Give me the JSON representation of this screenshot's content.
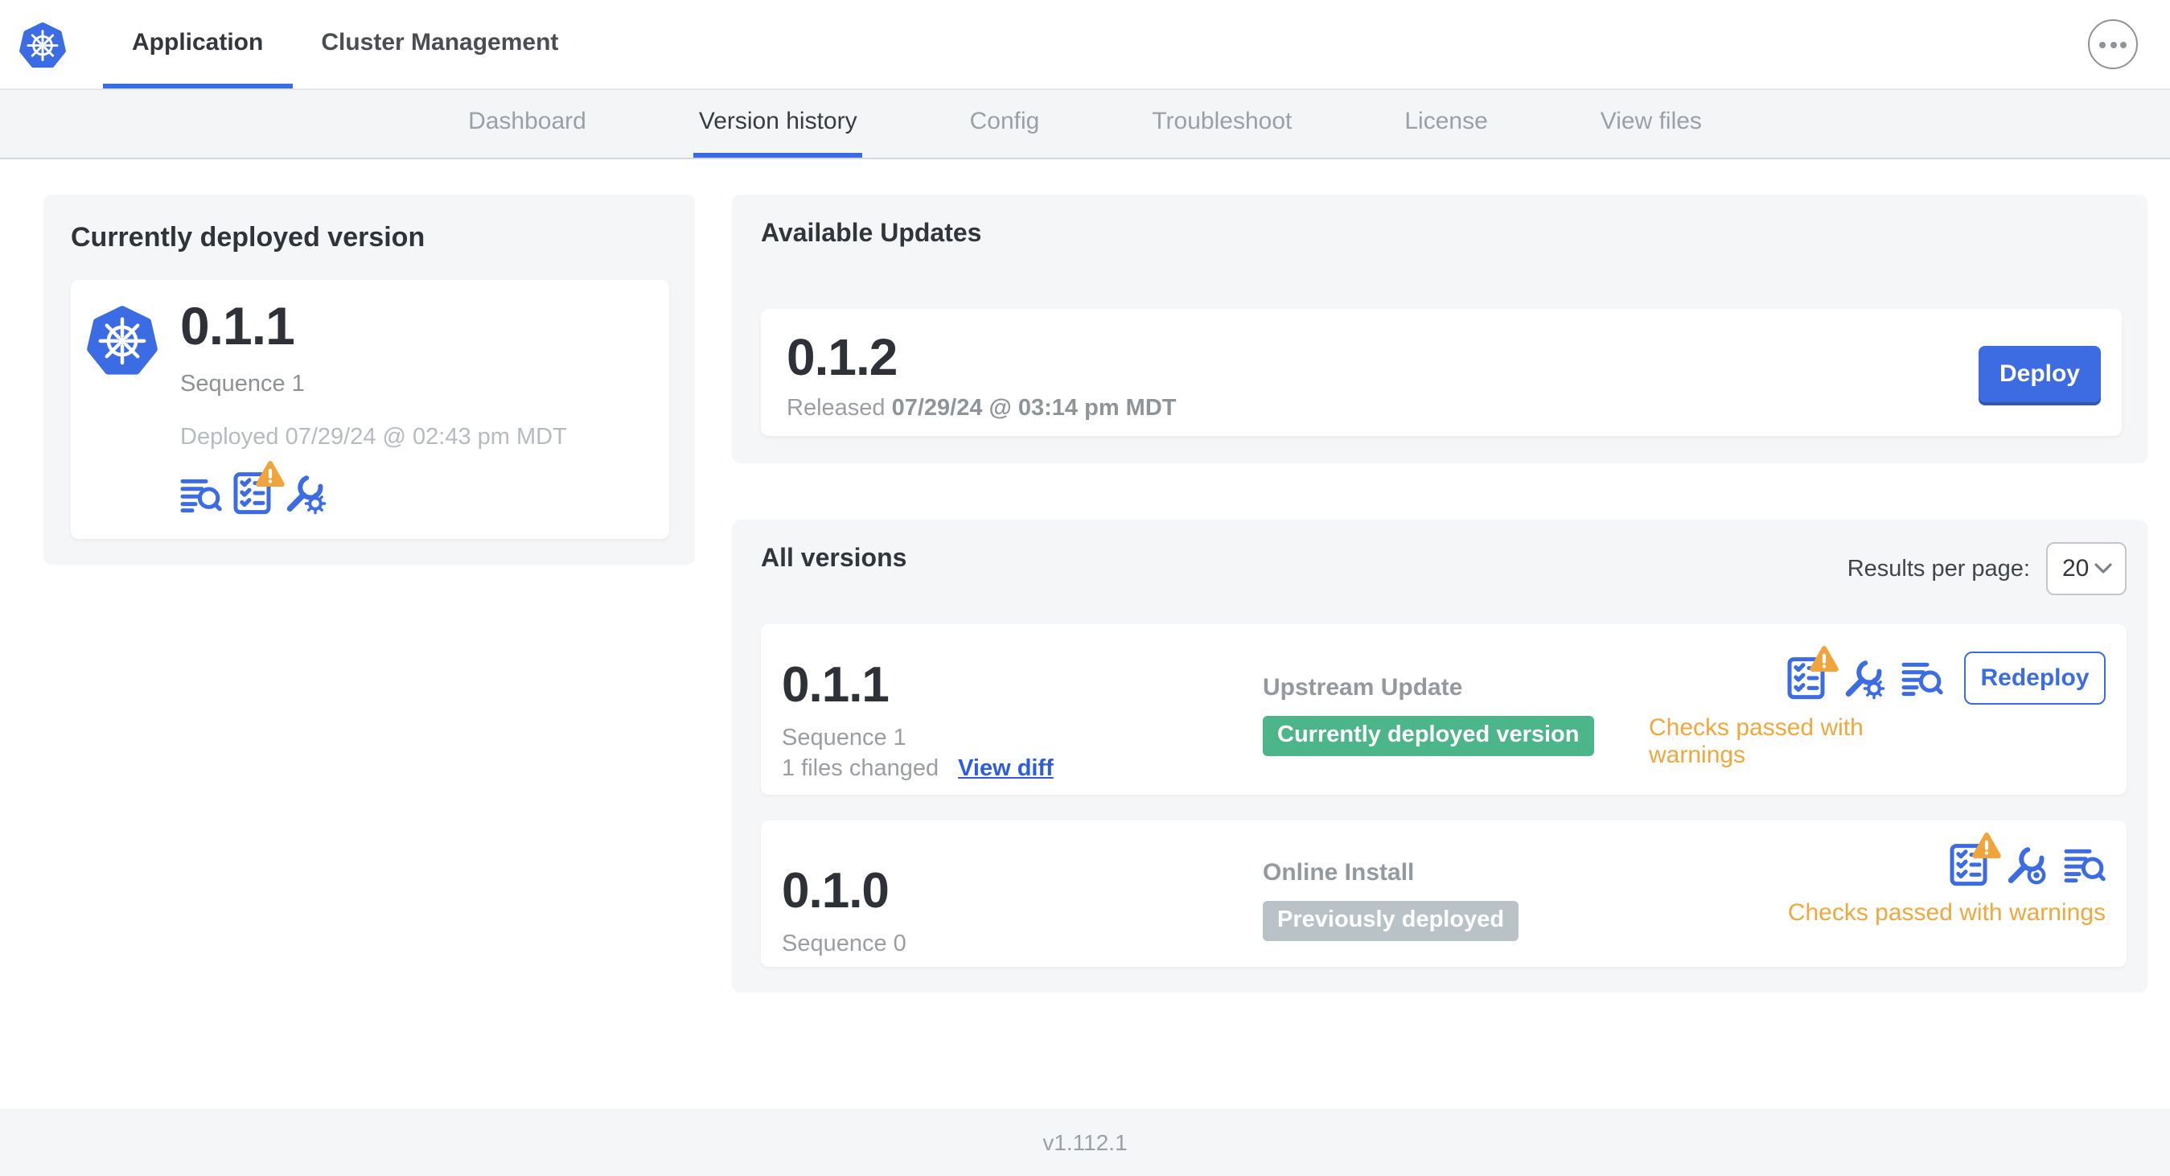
{
  "topnav": {
    "tabs": [
      {
        "label": "Application"
      },
      {
        "label": "Cluster Management"
      }
    ]
  },
  "subnav": {
    "tabs": [
      "Dashboard",
      "Version history",
      "Config",
      "Troubleshoot",
      "License",
      "View files"
    ],
    "active": "Version history"
  },
  "deployed": {
    "title": "Currently deployed version",
    "version": "0.1.1",
    "sequence": "Sequence 1",
    "deployed_at": "Deployed 07/29/24 @ 02:43 pm MDT"
  },
  "available_updates": {
    "title": "Available Updates",
    "version": "0.1.2",
    "released_label": "Released",
    "released_at": "07/29/24 @ 03:14 pm MDT",
    "deploy_label": "Deploy"
  },
  "all_versions": {
    "title": "All versions",
    "results_per_page_label": "Results per page:",
    "results_per_page_value": "20",
    "rows": [
      {
        "version": "0.1.1",
        "sequence": "Sequence 1",
        "files_changed": "1 files changed",
        "view_diff_label": "View diff",
        "source": "Upstream Update",
        "badge": "Currently deployed version",
        "badge_color": "#4cb589",
        "checks": "Checks passed with warnings",
        "action_label": "Redeploy"
      },
      {
        "version": "0.1.0",
        "sequence": "Sequence 0",
        "source": "Online Install",
        "badge": "Previously deployed",
        "badge_color": "#b9c2c6",
        "checks": "Checks passed with warnings"
      }
    ]
  },
  "footer": {
    "app_version": "v1.112.1"
  },
  "colors": {
    "accent": "#3b6ce4",
    "warning_text": "#f0a83d",
    "green_badge": "#4cb589",
    "gray_badge": "#b9c2c6"
  }
}
